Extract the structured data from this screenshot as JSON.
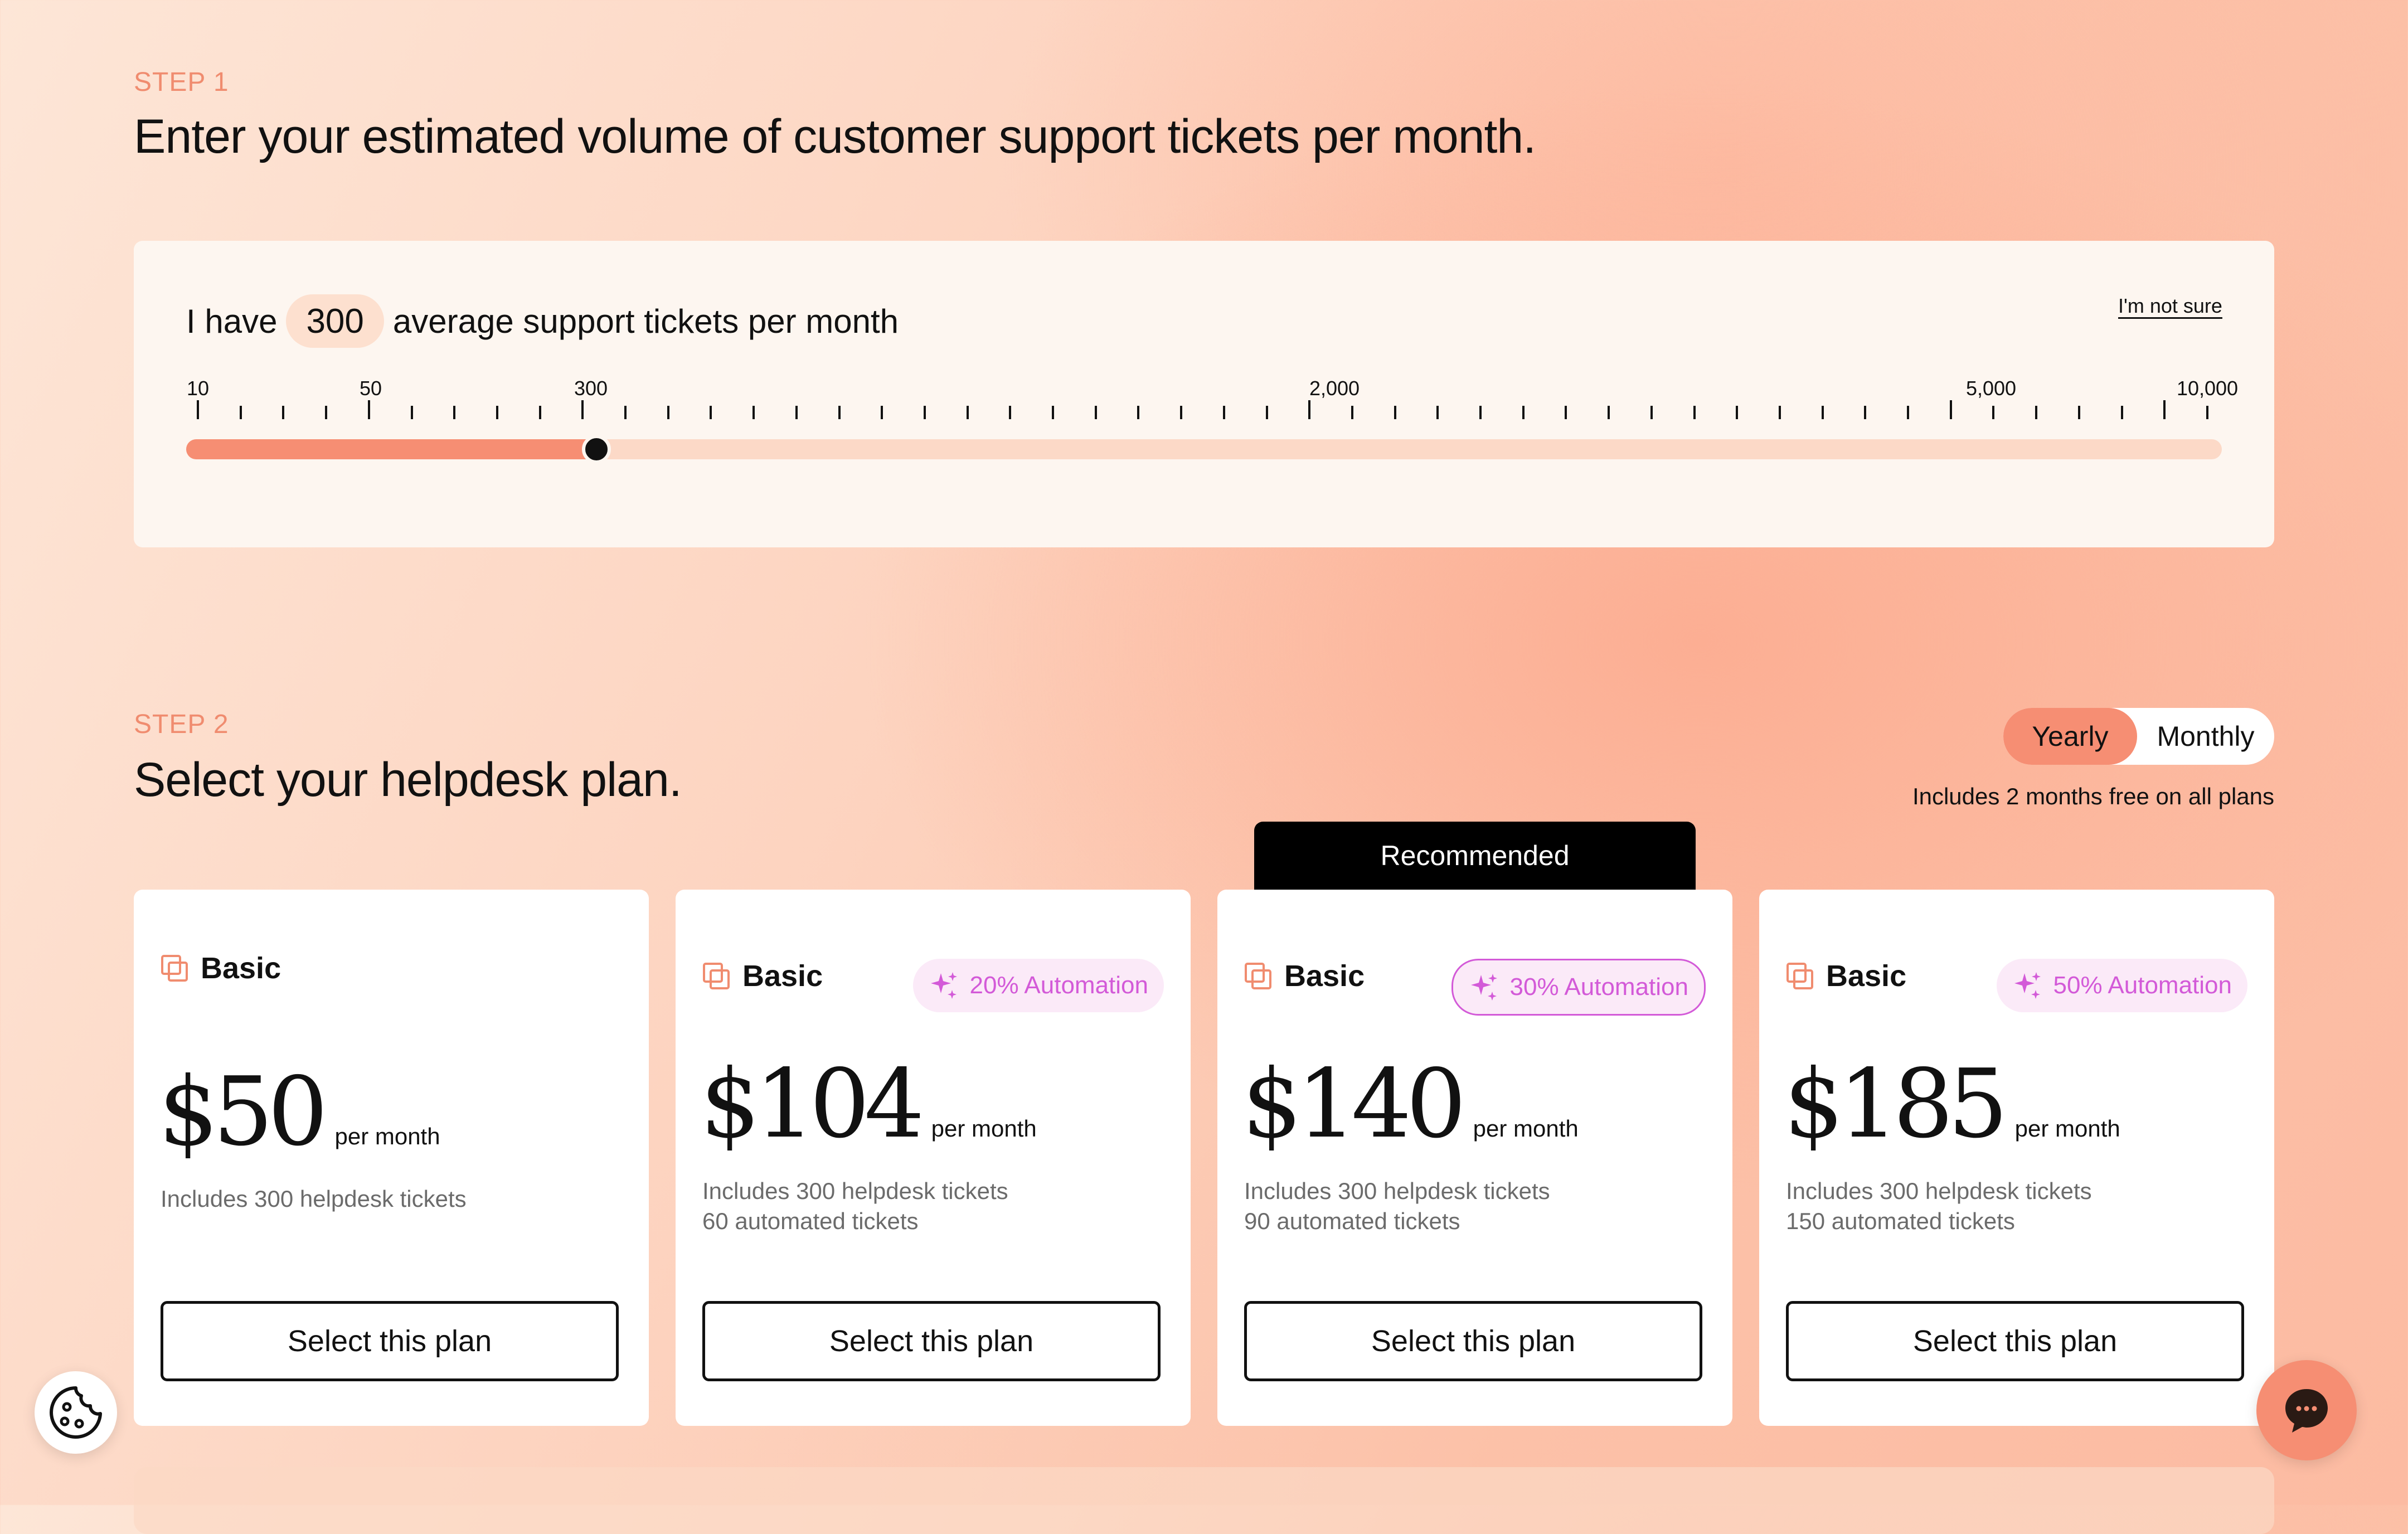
{
  "step1": {
    "label": "STEP 1",
    "title": "Enter your estimated volume of customer support tickets per month.",
    "sentence_prefix": "I have",
    "tickets_value": "300",
    "sentence_suffix": "average support tickets per month",
    "not_sure_link": "I'm not sure",
    "slider": {
      "tick_labels": [
        "10",
        "50",
        "300",
        "2,000",
        "5,000",
        "10,000"
      ],
      "current_value": 300,
      "fill_fraction": 0.2
    }
  },
  "step2": {
    "label": "STEP 2",
    "title": "Select your helpdesk plan.",
    "billing_toggle": {
      "options": [
        "Yearly",
        "Monthly"
      ],
      "selected": "Yearly"
    },
    "includes_note": "Includes 2 months free on all plans",
    "recommended_label": "Recommended"
  },
  "plans": [
    {
      "name": "Basic",
      "automation_badge": "",
      "price": "$50",
      "period": "per month",
      "details": [
        "Includes 300 helpdesk tickets"
      ],
      "button": "Select this plan"
    },
    {
      "name": "Basic",
      "automation_badge": "20% Automation",
      "price": "$104",
      "period": "per month",
      "details": [
        "Includes 300 helpdesk tickets",
        "60 automated tickets"
      ],
      "button": "Select this plan"
    },
    {
      "name": "Basic",
      "automation_badge": "30% Automation",
      "price": "$140",
      "period": "per month",
      "details": [
        "Includes 300 helpdesk tickets",
        "90 automated tickets"
      ],
      "button": "Select this plan",
      "recommended": true
    },
    {
      "name": "Basic",
      "automation_badge": "50% Automation",
      "price": "$185",
      "period": "per month",
      "details": [
        "Includes 300 helpdesk tickets",
        "150 automated tickets"
      ],
      "button": "Select this plan"
    }
  ],
  "icons": {
    "plan": "stacked-squares-icon",
    "automation": "sparkle-icon",
    "cookie": "cookie-icon",
    "chat": "chat-bubble-icon"
  },
  "colors": {
    "accent": "#f68e73",
    "step_label": "#f08c6f",
    "automation": "#d35ad8",
    "recommended_bg": "#000000"
  }
}
